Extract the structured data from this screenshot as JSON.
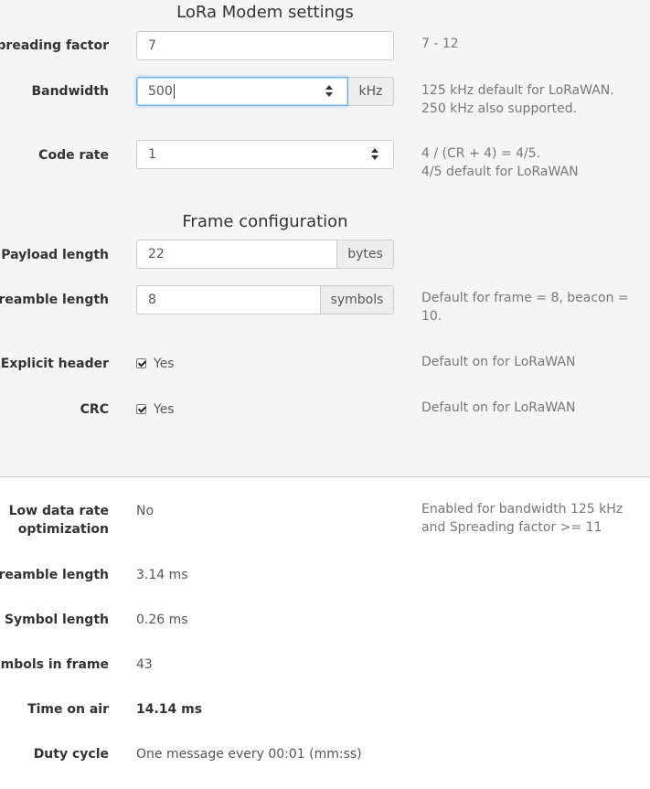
{
  "modem": {
    "title": "LoRa Modem settings",
    "spreading_factor": {
      "label": "Spreading factor",
      "value": "7",
      "help": "7 - 12"
    },
    "bandwidth": {
      "label": "Bandwidth",
      "value": "500",
      "unit": "kHz",
      "help_line1": "125 kHz default for LoRaWAN.",
      "help_line2": "250 kHz also supported."
    },
    "code_rate": {
      "label": "Code rate",
      "value": "1",
      "help_line1": "4 / (CR + 4) = 4/5.",
      "help_line2": "4/5 default for LoRaWAN"
    }
  },
  "frame": {
    "title": "Frame configuration",
    "payload_length": {
      "label": "Payload length",
      "value": "22",
      "unit": "bytes"
    },
    "preamble_length": {
      "label": "Preamble length",
      "value": "8",
      "unit": "symbols",
      "help_line1": "Default for frame = 8, beacon =",
      "help_line2": "10."
    },
    "explicit_header": {
      "label": "Explicit header",
      "checked": true,
      "option": "Yes",
      "help": "Default on for LoRaWAN"
    },
    "crc": {
      "label": "CRC",
      "checked": true,
      "option": "Yes",
      "help": "Default on for LoRaWAN"
    }
  },
  "results": {
    "low_data_rate": {
      "label_line1": "Low data rate",
      "label_line2": "optimization",
      "value": "No",
      "help_line1": "Enabled for bandwidth 125 kHz",
      "help_line2": "and Spreading factor >= 11"
    },
    "preamble_length": {
      "label": "Preamble length",
      "value": "3.14 ms"
    },
    "symbol_length": {
      "label": "Symbol length",
      "value": "0.26 ms"
    },
    "symbols_in_frame": {
      "label": "Symbols in frame",
      "value": "43"
    },
    "time_on_air": {
      "label": "Time on air",
      "value": "14.14 ms"
    },
    "duty_cycle": {
      "label": "Duty cycle",
      "value": "One message every 00:01 (mm:ss)"
    }
  }
}
